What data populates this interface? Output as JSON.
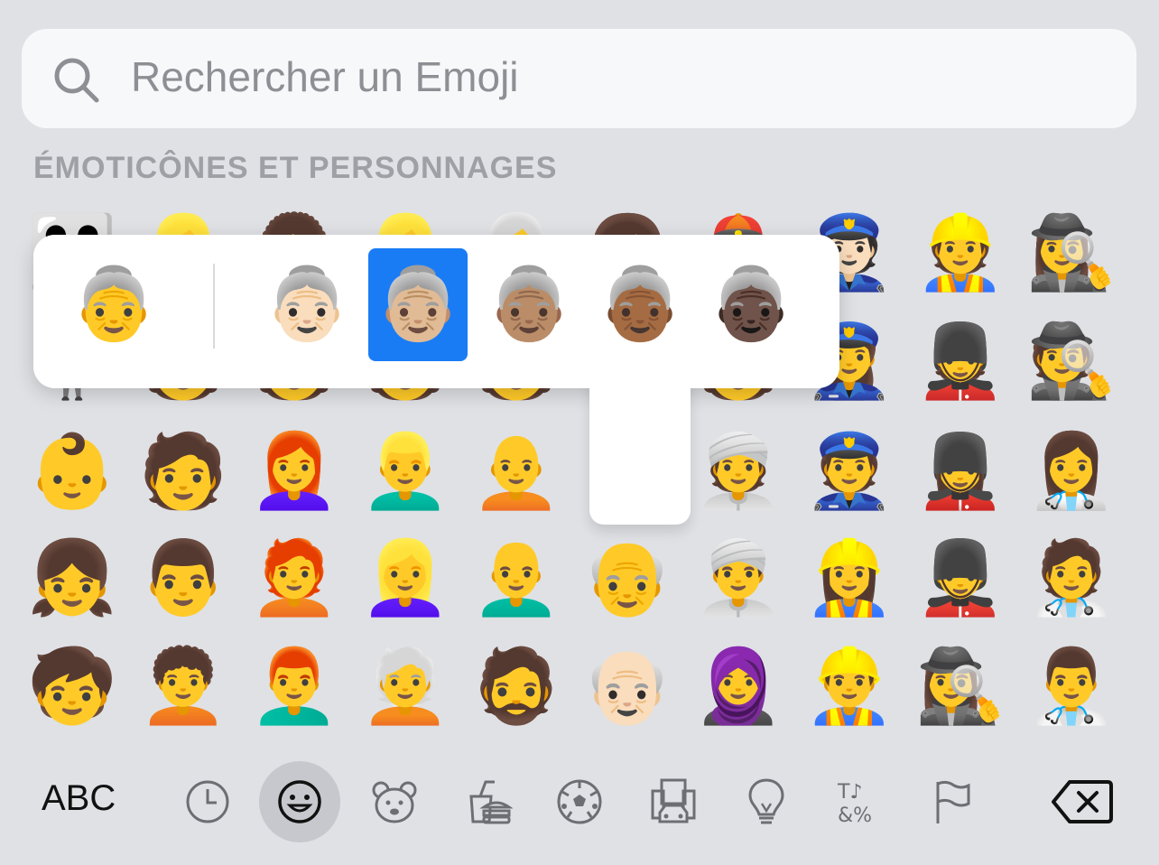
{
  "search": {
    "placeholder": "Rechercher un Emoji"
  },
  "section_title": "ÉMOTICÔNES ET PERSONNAGES",
  "grid_rows": [
    [
      "👪",
      "👱‍♀️",
      "👩‍🦱",
      "👱‍♀️",
      "👩‍🦳",
      "👩",
      "👲",
      "👮🏻",
      "👷",
      "🕵️‍♀️"
    ],
    [
      "🧍",
      "🧑",
      "🧑",
      "🧑",
      "🧑",
      "🧑",
      "🧑",
      "👮‍♀️",
      "💂",
      "🕵️"
    ],
    [
      "👶",
      "🧑",
      "👩‍🦰",
      "👱‍♂️",
      "🧑‍🦲",
      "",
      "👳",
      "👮",
      "💂‍♀️",
      "👩‍⚕️"
    ],
    [
      "👧",
      "👨",
      "🧑‍🦰",
      "👱‍♀️",
      "👨‍🦲",
      "👴",
      "👳‍♂️",
      "👷‍♀️",
      "💂‍♂️",
      "🧑‍⚕️"
    ],
    [
      "🧒",
      "🧑‍🦱",
      "👨‍🦰",
      "🧑‍🦳",
      "🧔",
      "👴🏻",
      "🧕",
      "👷‍♂️",
      "🕵️‍♀️",
      "👨‍⚕️"
    ]
  ],
  "popup": {
    "default": "👵",
    "variants": [
      "👵🏻",
      "👵🏼",
      "👵🏽",
      "👵🏾",
      "👵🏿"
    ],
    "selected_index": 1
  },
  "bottom_bar": {
    "abc_label": "ABC",
    "categories": [
      "recent-icon",
      "smiley-icon",
      "animal-icon",
      "food-icon",
      "activity-icon",
      "travel-icon",
      "objects-icon",
      "symbols-icon",
      "flags-icon"
    ],
    "active_category": "smiley-icon"
  },
  "colors": {
    "selected": "#1a7cf5",
    "background": "#dfe1e5"
  }
}
